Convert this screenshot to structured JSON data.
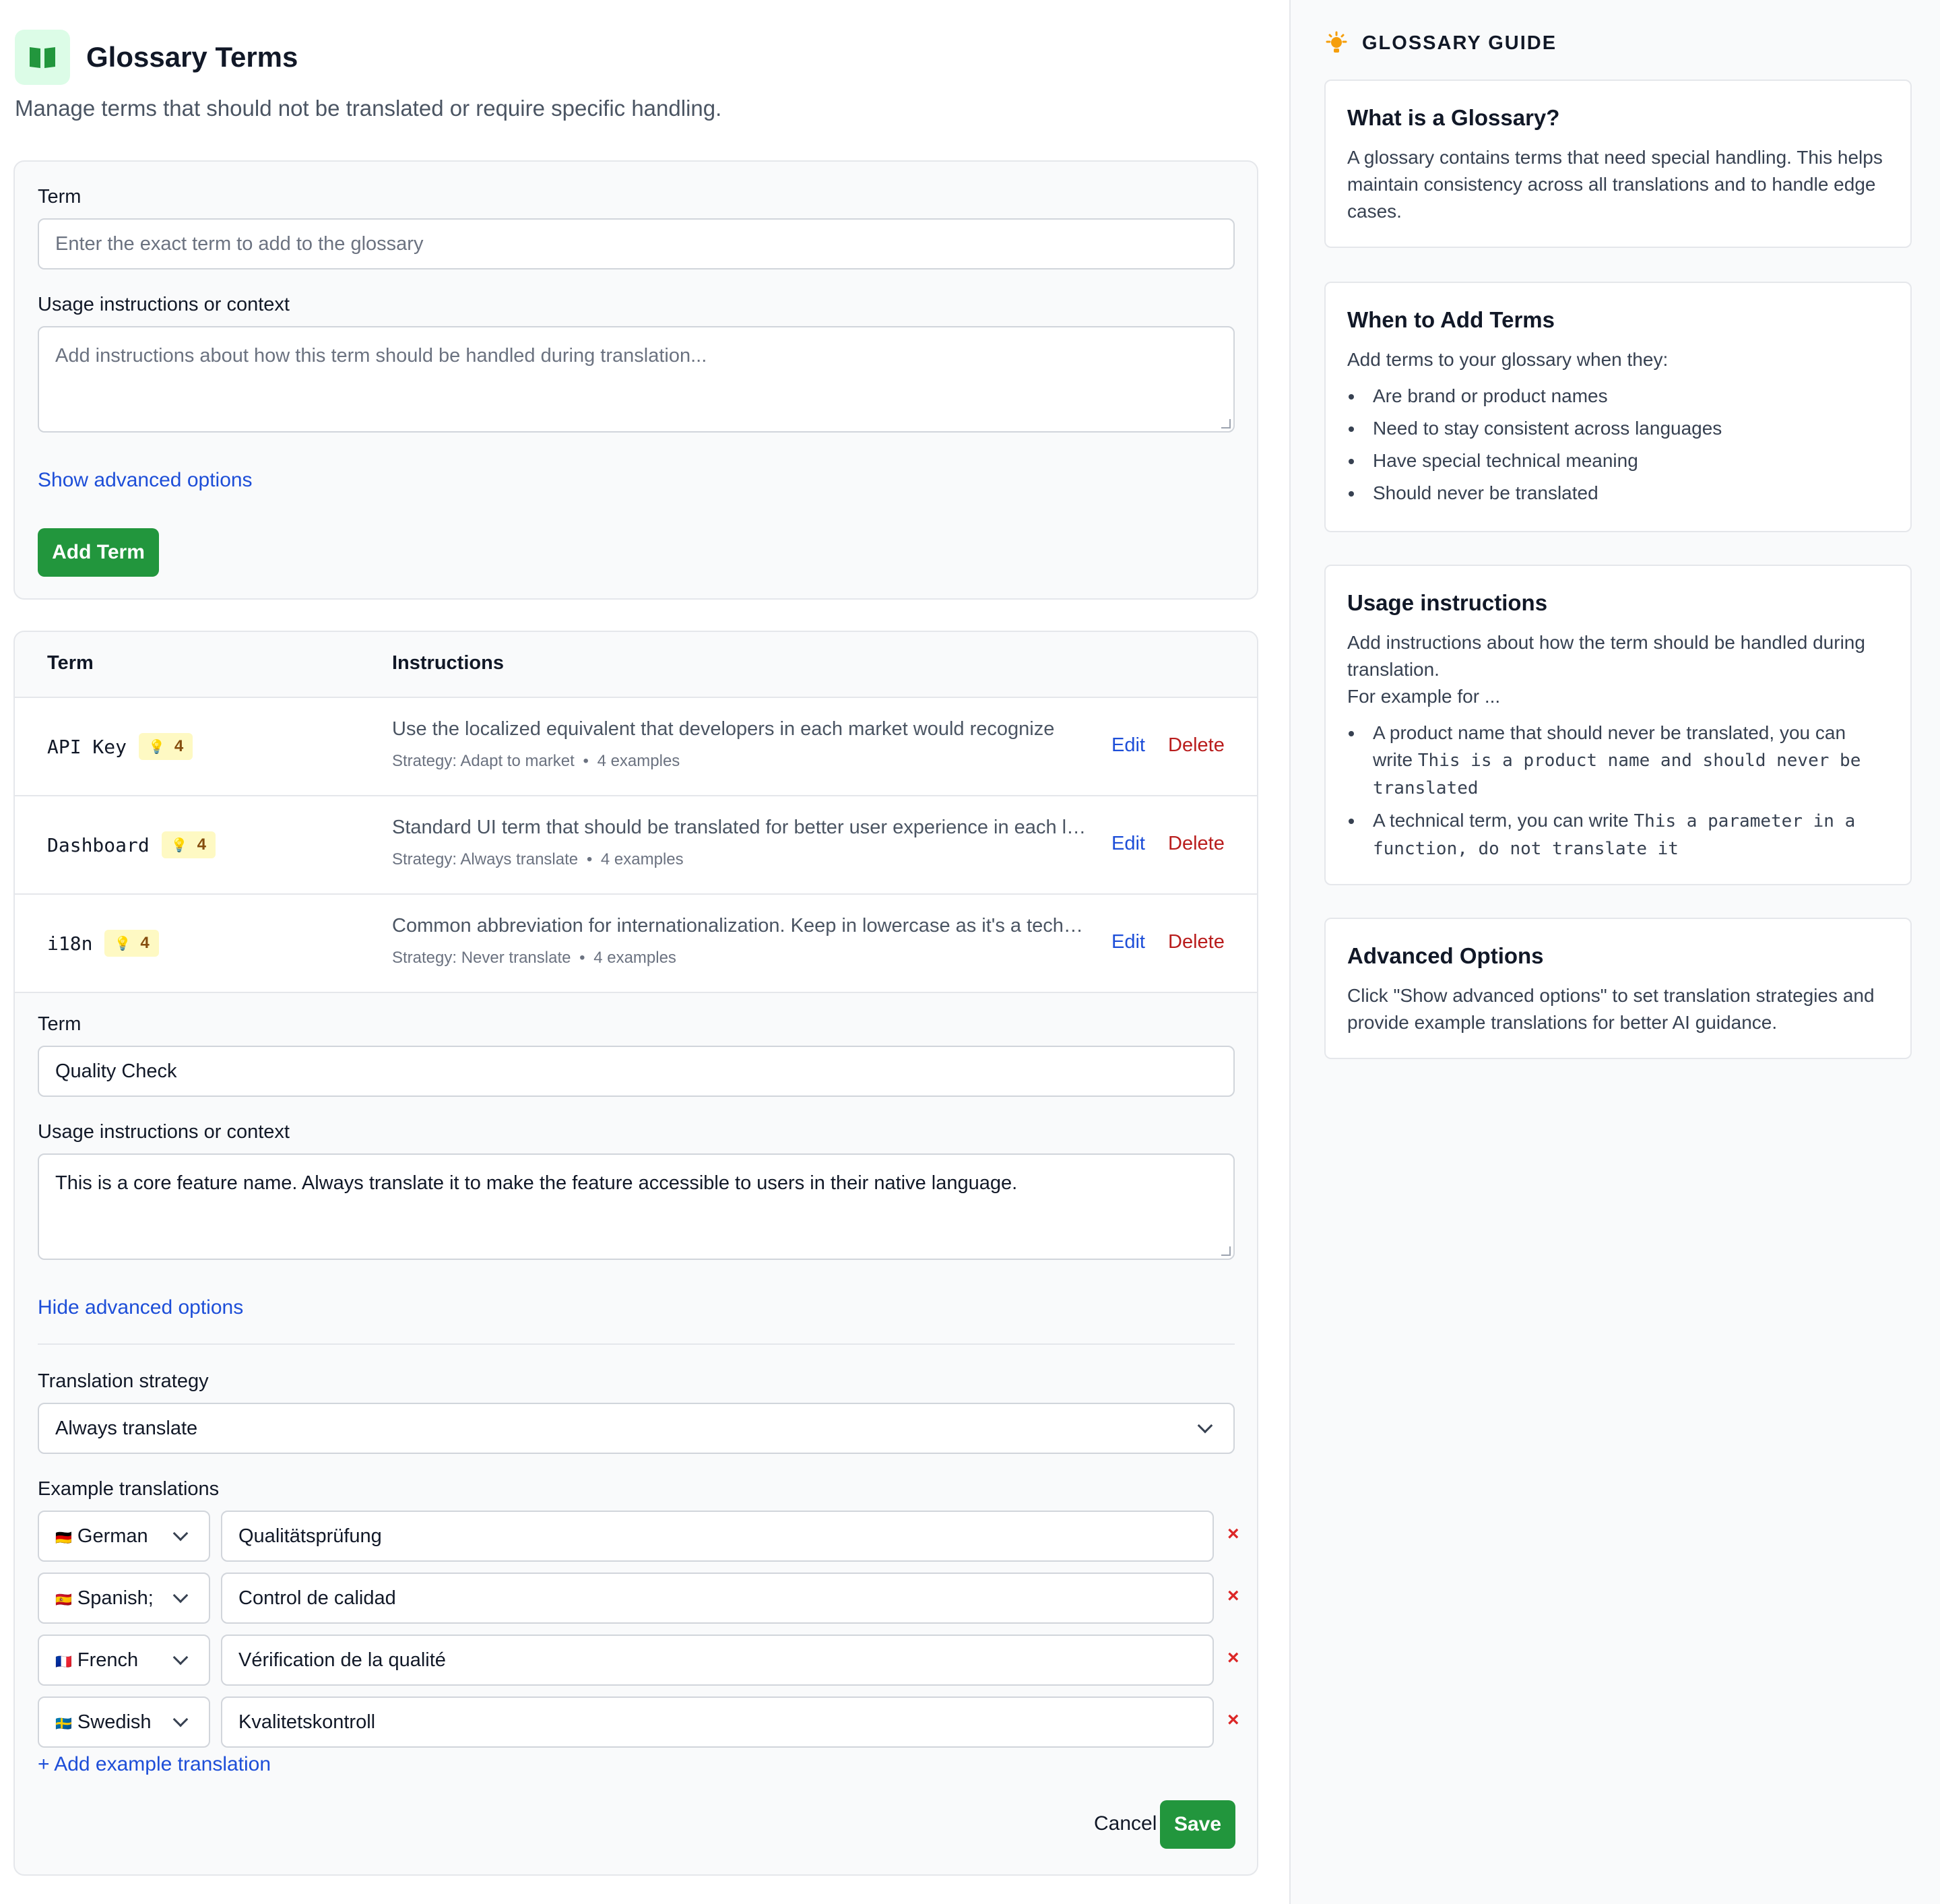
{
  "header": {
    "title": "Glossary Terms",
    "subtitle": "Manage terms that should not be translated or require specific handling."
  },
  "add_form": {
    "term_label": "Term",
    "term_placeholder": "Enter the exact term to add to the glossary",
    "context_label": "Usage instructions or context",
    "context_placeholder": "Add instructions about how this term should be handled during translation...",
    "advanced_link": "Show advanced options",
    "add_button": "Add Term"
  },
  "table": {
    "headers": {
      "term": "Term",
      "instructions": "Instructions"
    },
    "rows": [
      {
        "term": "API Key",
        "examples_count": "4",
        "instructions": "Use the localized equivalent that developers in each market would recognize",
        "strategy": "Strategy: Adapt to market",
        "examples": "4 examples",
        "edit": "Edit",
        "delete": "Delete"
      },
      {
        "term": "Dashboard",
        "examples_count": "4",
        "instructions": "Standard UI term that should be translated for better user experience in each language",
        "strategy": "Strategy: Always translate",
        "examples": "4 examples",
        "edit": "Edit",
        "delete": "Delete"
      },
      {
        "term": "i18n",
        "examples_count": "4",
        "instructions": "Common abbreviation for internationalization. Keep in lowercase as it's a technical term",
        "strategy": "Strategy: Never translate",
        "examples": "4 examples",
        "edit": "Edit",
        "delete": "Delete"
      }
    ]
  },
  "edit_form": {
    "term_label": "Term",
    "term_value": "Quality Check",
    "context_label": "Usage instructions or context",
    "context_value": "This is a core feature name. Always translate it to make the feature accessible to users in their native language.",
    "advanced_link": "Hide advanced options",
    "strategy_label": "Translation strategy",
    "strategy_value": "Always translate",
    "examples_label": "Example translations",
    "examples": [
      {
        "flag": "🇩🇪",
        "language": "German",
        "value": "Qualitätsprüfung",
        "remove": "×"
      },
      {
        "flag": "🇪🇸",
        "language": "Spanish;",
        "value": "Control de calidad",
        "remove": "×"
      },
      {
        "flag": "🇫🇷",
        "language": "French",
        "value": "Vérification de la qualité",
        "remove": "×"
      },
      {
        "flag": "🇸🇪",
        "language": "Swedish",
        "value": "Kvalitetskontroll",
        "remove": "×"
      }
    ],
    "add_example": "+ Add example translation",
    "cancel": "Cancel",
    "save": "Save"
  },
  "guide": {
    "title": "GLOSSARY GUIDE",
    "what": {
      "title": "What is a Glossary?",
      "body": "A glossary contains terms that need special handling. This helps maintain consistency across all translations and to handle edge cases."
    },
    "when": {
      "title": "When to Add Terms",
      "intro": "Add terms to your glossary when they:",
      "items": [
        "Are brand or product names",
        "Need to stay consistent across languages",
        "Have special technical meaning",
        "Should never be translated"
      ]
    },
    "usage": {
      "title": "Usage instructions",
      "line1": "Add instructions about how the term should be handled during translation.",
      "line2": "For example for ...",
      "item1_text": "A product name that should never be translated, you can write ",
      "item1_code": "This is a product name and should never be translated",
      "item2_text": "A technical term, you can write ",
      "item2_code": "This a parameter in a function, do not translate it"
    },
    "advanced": {
      "title": "Advanced Options",
      "body": "Click \"Show advanced options\" to set translation strategies and provide example translations for better AI guidance."
    }
  },
  "colors": {
    "brand_green": "#22963d",
    "link_blue": "#1d4ed8",
    "delete_red": "#b91c1c",
    "badge_yellow": "#fef9c3"
  },
  "icons": {
    "header": "book-open-icon",
    "guide": "lightbulb-icon",
    "badge": "lightbulb-icon",
    "select": "chevron-down-icon",
    "remove": "close-icon"
  }
}
